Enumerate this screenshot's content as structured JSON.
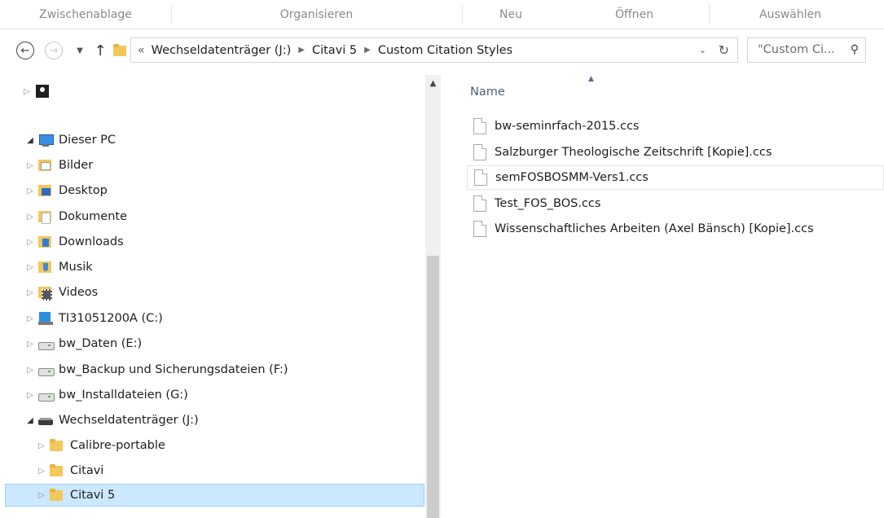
{
  "ribbon": {
    "groups": [
      "Zwischenablage",
      "Organisieren",
      "Neu",
      "Öffnen",
      "Auswählen"
    ]
  },
  "nav": {
    "back_icon": "back-arrow-icon",
    "forward_icon": "forward-arrow-icon",
    "recent_icon": "chevron-down-icon",
    "up_icon": "up-arrow-icon",
    "overflow": "«",
    "breadcrumbs": [
      "Wechseldatenträger (J:)",
      "Citavi 5",
      "Custom Citation Styles"
    ],
    "search_placeholder": "\"Custom Ci..."
  },
  "tree": {
    "items": [
      {
        "label": "",
        "icon": "user-icon"
      },
      {
        "label": "Dieser PC",
        "icon": "computer-icon"
      },
      {
        "label": "Bilder",
        "icon": "pictures-folder-icon"
      },
      {
        "label": "Desktop",
        "icon": "desktop-folder-icon"
      },
      {
        "label": "Dokumente",
        "icon": "documents-folder-icon"
      },
      {
        "label": "Downloads",
        "icon": "downloads-folder-icon"
      },
      {
        "label": "Musik",
        "icon": "music-folder-icon"
      },
      {
        "label": "Videos",
        "icon": "videos-folder-icon"
      },
      {
        "label": "TI31051200A (C:)",
        "icon": "system-drive-icon"
      },
      {
        "label": "bw_Daten (E:)",
        "icon": "drive-icon"
      },
      {
        "label": "bw_Backup und Sicherungsdateien (F:)",
        "icon": "drive-icon"
      },
      {
        "label": "bw_Installdateien (G:)",
        "icon": "drive-icon"
      },
      {
        "label": "Wechseldatenträger (J:)",
        "icon": "removable-drive-icon"
      },
      {
        "label": "Calibre-portable",
        "icon": "folder-icon"
      },
      {
        "label": "Citavi",
        "icon": "folder-icon"
      },
      {
        "label": "Citavi 5",
        "icon": "folder-icon"
      }
    ]
  },
  "files": {
    "column_header": "Name",
    "items": [
      "bw-seminrfach-2015.ccs",
      "Salzburger Theologische Zeitschrift [Kopie].ccs",
      "semFOSBOSMM-Vers1.ccs",
      "Test_FOS_BOS.ccs",
      "Wissenschaftliches Arbeiten (Axel Bänsch) [Kopie].ccs"
    ]
  }
}
